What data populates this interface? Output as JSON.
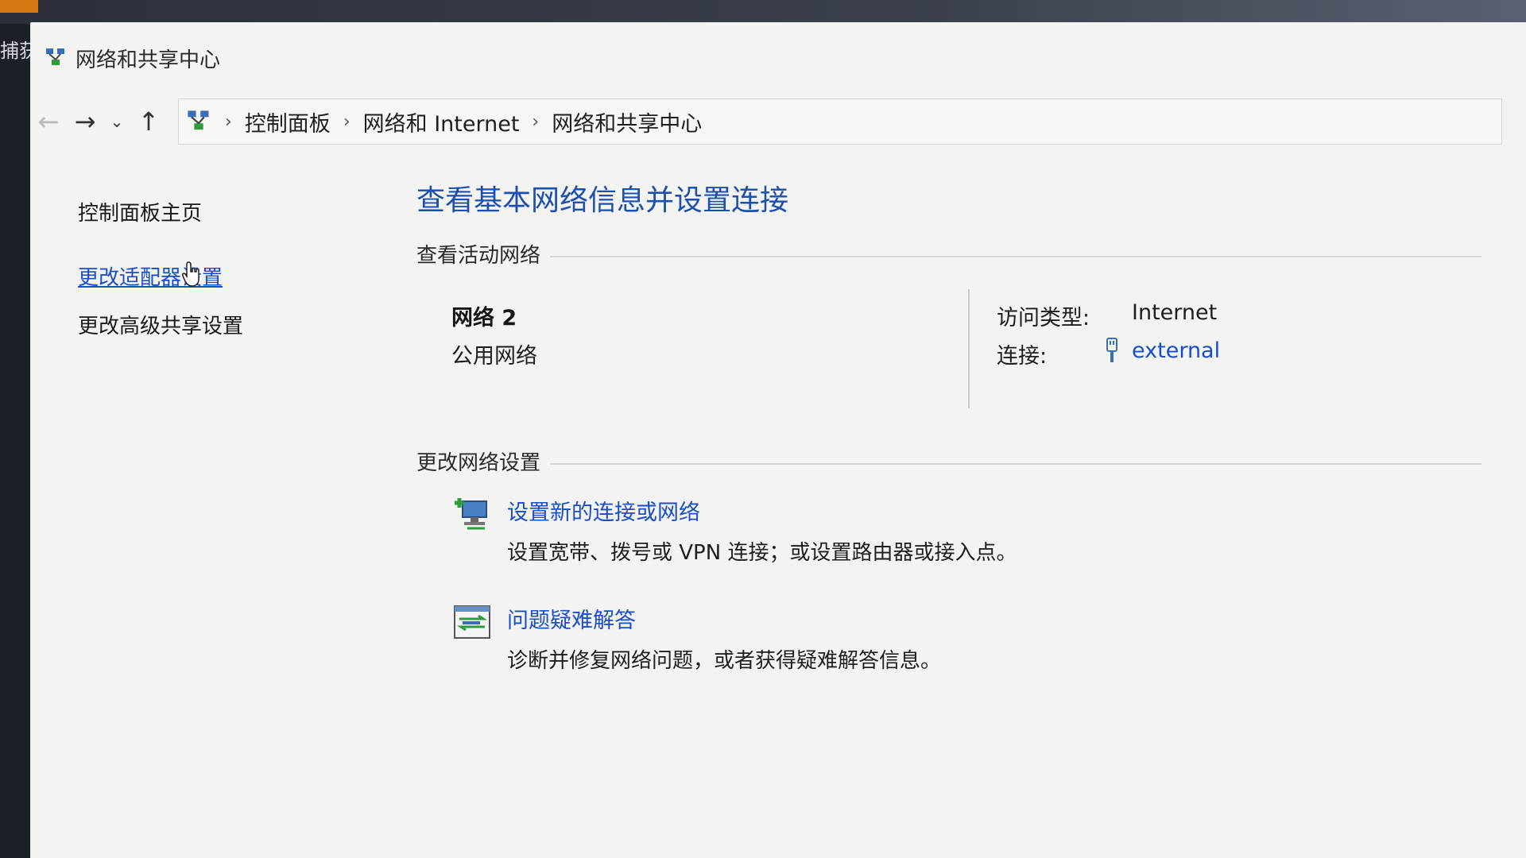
{
  "desktop": {
    "left_glyph": "捕获"
  },
  "window": {
    "title": "网络和共享中心"
  },
  "address": {
    "crumbs": [
      "控制面板",
      "网络和 Internet",
      "网络和共享中心"
    ]
  },
  "sidebar": {
    "items": [
      {
        "label": "控制面板主页"
      },
      {
        "label": "更改适配器设置"
      },
      {
        "label": "更改高级共享设置"
      }
    ]
  },
  "main": {
    "title": "查看基本网络信息并设置连接",
    "active_networks_header": "查看活动网络",
    "network": {
      "name": "网络 2",
      "type": "公用网络",
      "access_label": "访问类型:",
      "access_value": "Internet",
      "connection_label": "连接:",
      "connection_value": "external"
    },
    "change_settings_header": "更改网络设置",
    "tasks": [
      {
        "title": "设置新的连接或网络",
        "desc": "设置宽带、拨号或 VPN 连接；或设置路由器或接入点。"
      },
      {
        "title": "问题疑难解答",
        "desc": "诊断并修复网络问题，或者获得疑难解答信息。"
      }
    ]
  },
  "colors": {
    "link": "#1a4dc9",
    "title": "#1d4fae",
    "window_bg": "#f3f3f1"
  },
  "icons": [
    "network-center-icon",
    "back-arrow-icon",
    "forward-arrow-icon",
    "recent-dropdown-icon",
    "up-arrow-icon",
    "ethernet-icon",
    "new-connection-icon",
    "troubleshoot-icon",
    "mouse-cursor-icon"
  ]
}
